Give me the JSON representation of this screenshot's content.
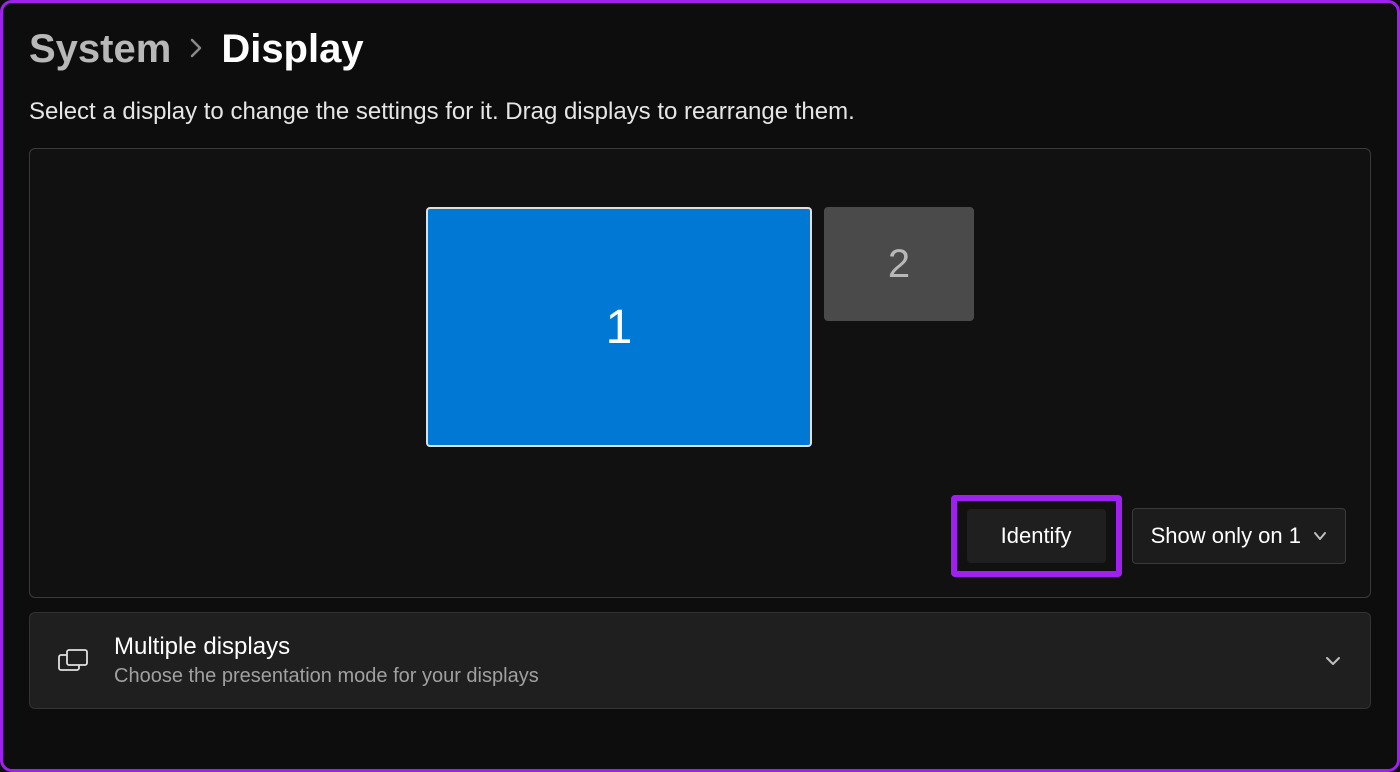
{
  "breadcrumb": {
    "parent": "System",
    "current": "Display"
  },
  "instruction": "Select a display to change the settings for it. Drag displays to rearrange them.",
  "displays": {
    "primary_label": "1",
    "secondary_label": "2"
  },
  "actions": {
    "identify_label": "Identify",
    "projection_selected": "Show only on 1"
  },
  "multiple_displays_card": {
    "title": "Multiple displays",
    "subtitle": "Choose the presentation mode for your displays"
  }
}
